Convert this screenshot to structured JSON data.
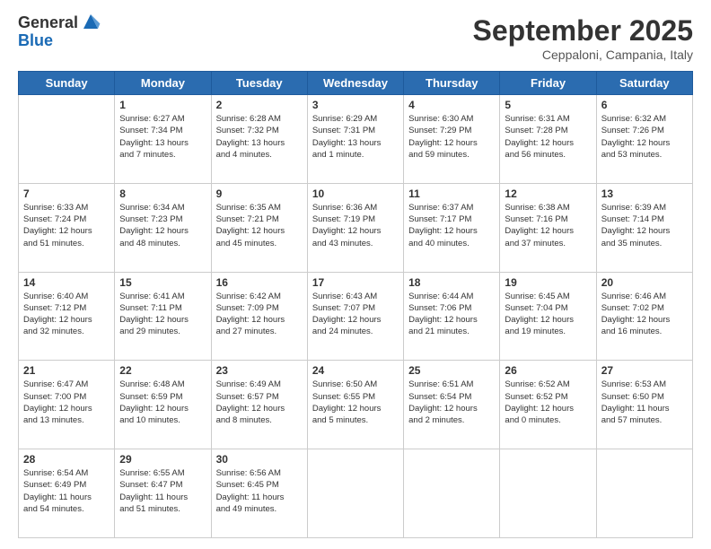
{
  "logo": {
    "general": "General",
    "blue": "Blue"
  },
  "title": "September 2025",
  "subtitle": "Ceppaloni, Campania, Italy",
  "days_of_week": [
    "Sunday",
    "Monday",
    "Tuesday",
    "Wednesday",
    "Thursday",
    "Friday",
    "Saturday"
  ],
  "weeks": [
    [
      {
        "day": "",
        "content": ""
      },
      {
        "day": "1",
        "content": "Sunrise: 6:27 AM\nSunset: 7:34 PM\nDaylight: 13 hours\nand 7 minutes."
      },
      {
        "day": "2",
        "content": "Sunrise: 6:28 AM\nSunset: 7:32 PM\nDaylight: 13 hours\nand 4 minutes."
      },
      {
        "day": "3",
        "content": "Sunrise: 6:29 AM\nSunset: 7:31 PM\nDaylight: 13 hours\nand 1 minute."
      },
      {
        "day": "4",
        "content": "Sunrise: 6:30 AM\nSunset: 7:29 PM\nDaylight: 12 hours\nand 59 minutes."
      },
      {
        "day": "5",
        "content": "Sunrise: 6:31 AM\nSunset: 7:28 PM\nDaylight: 12 hours\nand 56 minutes."
      },
      {
        "day": "6",
        "content": "Sunrise: 6:32 AM\nSunset: 7:26 PM\nDaylight: 12 hours\nand 53 minutes."
      }
    ],
    [
      {
        "day": "7",
        "content": "Sunrise: 6:33 AM\nSunset: 7:24 PM\nDaylight: 12 hours\nand 51 minutes."
      },
      {
        "day": "8",
        "content": "Sunrise: 6:34 AM\nSunset: 7:23 PM\nDaylight: 12 hours\nand 48 minutes."
      },
      {
        "day": "9",
        "content": "Sunrise: 6:35 AM\nSunset: 7:21 PM\nDaylight: 12 hours\nand 45 minutes."
      },
      {
        "day": "10",
        "content": "Sunrise: 6:36 AM\nSunset: 7:19 PM\nDaylight: 12 hours\nand 43 minutes."
      },
      {
        "day": "11",
        "content": "Sunrise: 6:37 AM\nSunset: 7:17 PM\nDaylight: 12 hours\nand 40 minutes."
      },
      {
        "day": "12",
        "content": "Sunrise: 6:38 AM\nSunset: 7:16 PM\nDaylight: 12 hours\nand 37 minutes."
      },
      {
        "day": "13",
        "content": "Sunrise: 6:39 AM\nSunset: 7:14 PM\nDaylight: 12 hours\nand 35 minutes."
      }
    ],
    [
      {
        "day": "14",
        "content": "Sunrise: 6:40 AM\nSunset: 7:12 PM\nDaylight: 12 hours\nand 32 minutes."
      },
      {
        "day": "15",
        "content": "Sunrise: 6:41 AM\nSunset: 7:11 PM\nDaylight: 12 hours\nand 29 minutes."
      },
      {
        "day": "16",
        "content": "Sunrise: 6:42 AM\nSunset: 7:09 PM\nDaylight: 12 hours\nand 27 minutes."
      },
      {
        "day": "17",
        "content": "Sunrise: 6:43 AM\nSunset: 7:07 PM\nDaylight: 12 hours\nand 24 minutes."
      },
      {
        "day": "18",
        "content": "Sunrise: 6:44 AM\nSunset: 7:06 PM\nDaylight: 12 hours\nand 21 minutes."
      },
      {
        "day": "19",
        "content": "Sunrise: 6:45 AM\nSunset: 7:04 PM\nDaylight: 12 hours\nand 19 minutes."
      },
      {
        "day": "20",
        "content": "Sunrise: 6:46 AM\nSunset: 7:02 PM\nDaylight: 12 hours\nand 16 minutes."
      }
    ],
    [
      {
        "day": "21",
        "content": "Sunrise: 6:47 AM\nSunset: 7:00 PM\nDaylight: 12 hours\nand 13 minutes."
      },
      {
        "day": "22",
        "content": "Sunrise: 6:48 AM\nSunset: 6:59 PM\nDaylight: 12 hours\nand 10 minutes."
      },
      {
        "day": "23",
        "content": "Sunrise: 6:49 AM\nSunset: 6:57 PM\nDaylight: 12 hours\nand 8 minutes."
      },
      {
        "day": "24",
        "content": "Sunrise: 6:50 AM\nSunset: 6:55 PM\nDaylight: 12 hours\nand 5 minutes."
      },
      {
        "day": "25",
        "content": "Sunrise: 6:51 AM\nSunset: 6:54 PM\nDaylight: 12 hours\nand 2 minutes."
      },
      {
        "day": "26",
        "content": "Sunrise: 6:52 AM\nSunset: 6:52 PM\nDaylight: 12 hours\nand 0 minutes."
      },
      {
        "day": "27",
        "content": "Sunrise: 6:53 AM\nSunset: 6:50 PM\nDaylight: 11 hours\nand 57 minutes."
      }
    ],
    [
      {
        "day": "28",
        "content": "Sunrise: 6:54 AM\nSunset: 6:49 PM\nDaylight: 11 hours\nand 54 minutes."
      },
      {
        "day": "29",
        "content": "Sunrise: 6:55 AM\nSunset: 6:47 PM\nDaylight: 11 hours\nand 51 minutes."
      },
      {
        "day": "30",
        "content": "Sunrise: 6:56 AM\nSunset: 6:45 PM\nDaylight: 11 hours\nand 49 minutes."
      },
      {
        "day": "",
        "content": ""
      },
      {
        "day": "",
        "content": ""
      },
      {
        "day": "",
        "content": ""
      },
      {
        "day": "",
        "content": ""
      }
    ]
  ]
}
